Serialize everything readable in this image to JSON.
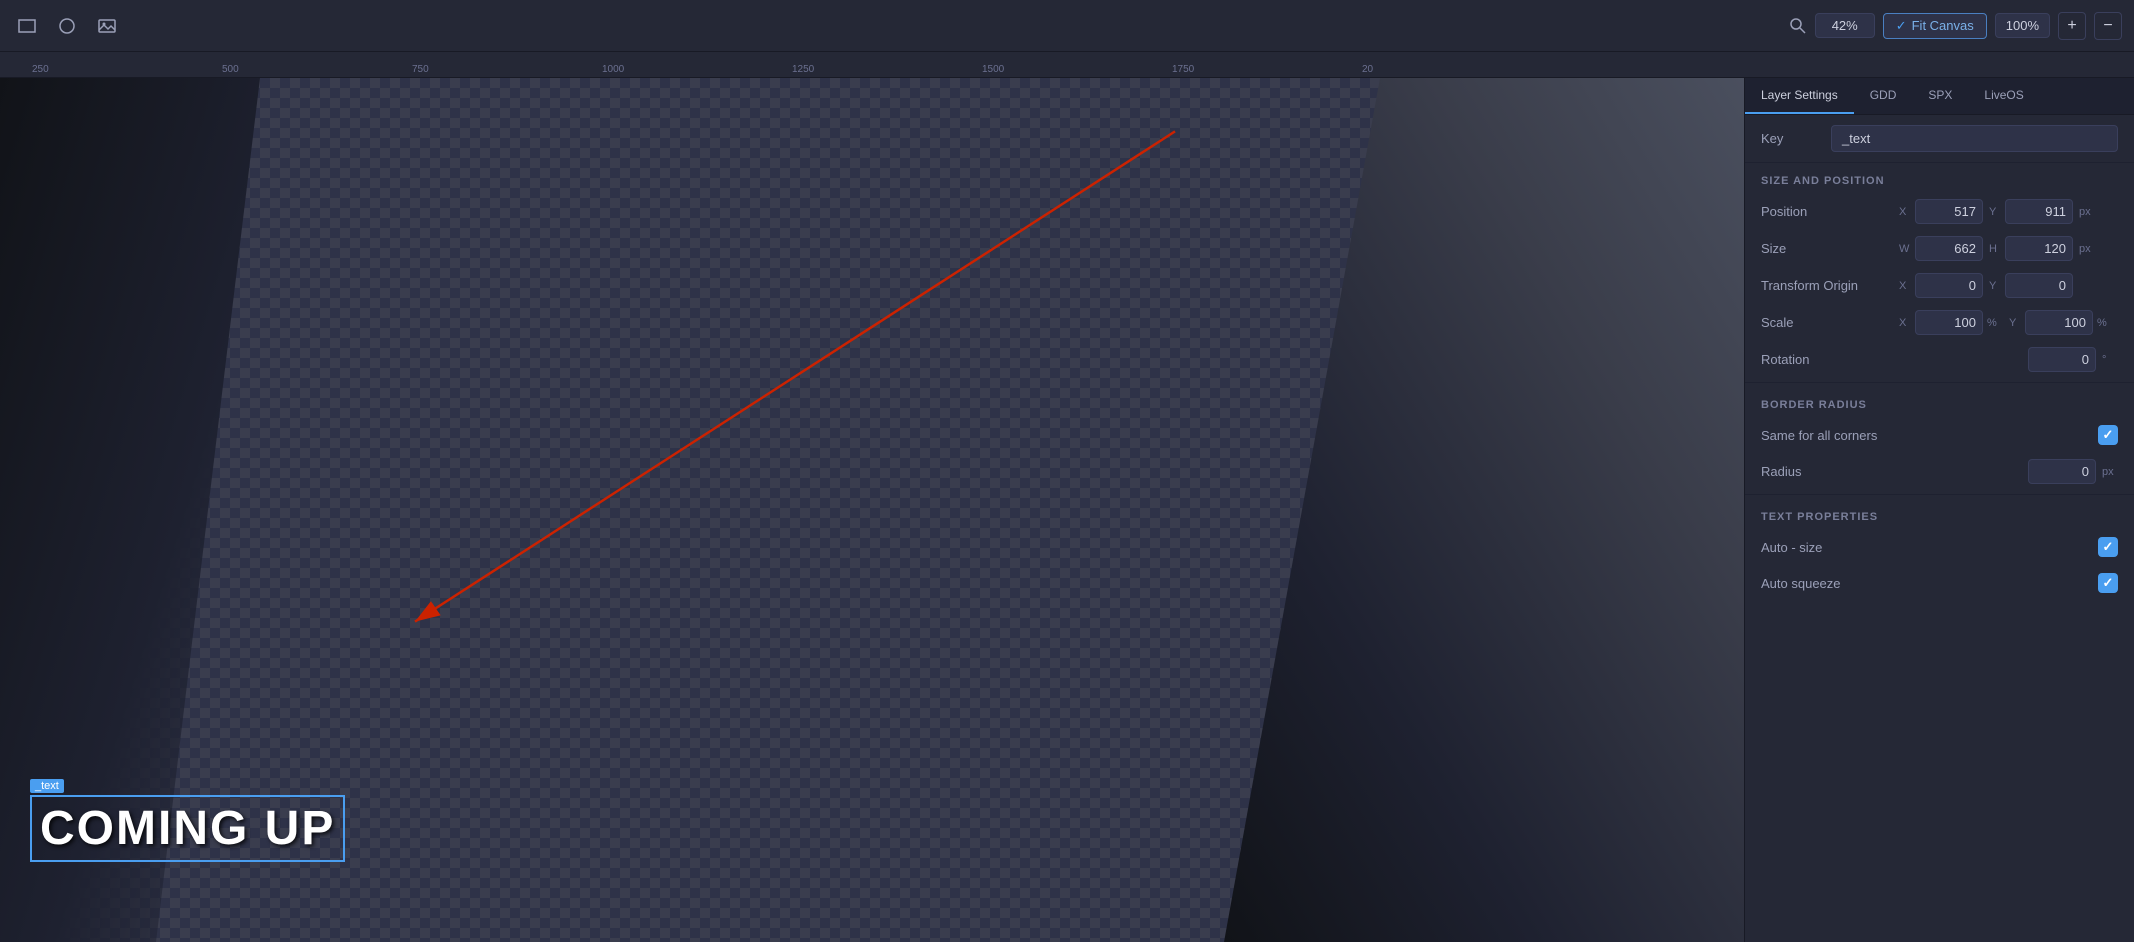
{
  "toolbar": {
    "zoom_percent": "42%",
    "fit_canvas_label": "Fit Canvas",
    "hundred_percent": "100%",
    "plus_label": "+",
    "minus_label": "−"
  },
  "ruler": {
    "marks": [
      "250",
      "500",
      "750",
      "1000",
      "1250",
      "1500",
      "1750",
      "20"
    ]
  },
  "canvas": {
    "text_label": "_text",
    "text_content": "COMING UP"
  },
  "right_panel": {
    "tabs": [
      {
        "label": "Layer Settings",
        "active": true
      },
      {
        "label": "GDD",
        "active": false
      },
      {
        "label": "SPX",
        "active": false
      },
      {
        "label": "LiveOS",
        "active": false
      }
    ],
    "key_label": "Key",
    "key_value": "_text",
    "sections": {
      "size_and_position": {
        "header": "SIZE AND POSITION",
        "position": {
          "label": "Position",
          "x": "517",
          "y": "911",
          "unit": "px"
        },
        "size": {
          "label": "Size",
          "w": "662",
          "h": "120",
          "unit": "px"
        },
        "transform_origin": {
          "label": "Transform Origin",
          "x": "0",
          "y": "0"
        },
        "scale": {
          "label": "Scale",
          "x": "100",
          "y": "100",
          "unit": "%"
        },
        "rotation": {
          "label": "Rotation",
          "value": "0",
          "unit": "°"
        }
      },
      "border_radius": {
        "header": "BORDER RADIUS",
        "same_for_all": {
          "label": "Same for all corners",
          "checked": true
        },
        "radius": {
          "label": "Radius",
          "value": "0",
          "unit": "px"
        }
      },
      "text_properties": {
        "header": "TEXT PROPERTIES",
        "auto_size": {
          "label": "Auto - size",
          "checked": true
        },
        "auto_squeeze": {
          "label": "Auto squeeze",
          "checked": true
        }
      }
    }
  }
}
